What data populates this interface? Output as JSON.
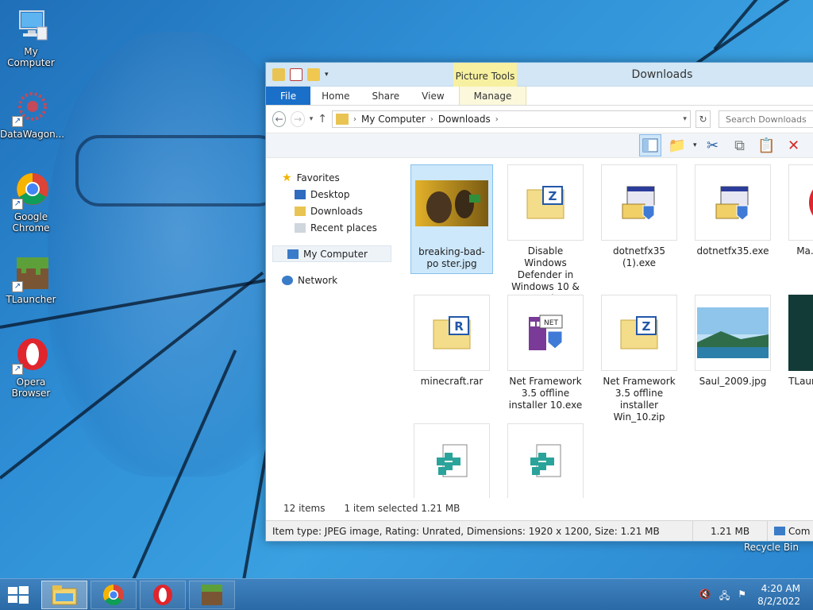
{
  "desktop": {
    "icons": [
      {
        "label": "My Computer"
      },
      {
        "label": "DataWagon..."
      },
      {
        "label": "Google Chrome"
      },
      {
        "label": "TLauncher"
      },
      {
        "label": "Opera Browser"
      }
    ],
    "recycle_bin": "Recycle Bin"
  },
  "window": {
    "title": "Downloads",
    "context_tab_group": "Picture Tools",
    "tabs": [
      "File",
      "Home",
      "Share",
      "View",
      "Manage"
    ],
    "address": {
      "crumbs": [
        "My Computer",
        "Downloads"
      ]
    },
    "search": {
      "placeholder": "Search Downloads"
    },
    "nav": {
      "favorites": "Favorites",
      "desktop": "Desktop",
      "downloads": "Downloads",
      "recent": "Recent places",
      "computer": "My Computer",
      "network": "Network"
    },
    "files": [
      {
        "name": "breaking-bad-poster.jpg",
        "display": "breaking-bad-po ster.jpg"
      },
      {
        "name": "Disable Windows Defender in Windows 10 & 11.zip"
      },
      {
        "name": "dotnetfx35 (1).exe"
      },
      {
        "name": "dotnetfx35.exe"
      },
      {
        "name": "Ma... T... Li..."
      },
      {
        "name": "minecraft.rar"
      },
      {
        "name": "Net Framework 3.5 offline installer 10.exe"
      },
      {
        "name": "Net Framework 3.5 offline installer Win_10.zip"
      },
      {
        "name": "Saul_2009.jpg"
      },
      {
        "name": "TLaun... nstall..."
      },
      {
        "name": ""
      },
      {
        "name": ""
      }
    ],
    "status": {
      "items": "12 items",
      "selected": "1 item selected  1.21 MB",
      "details": "Item type: JPEG image, Rating: Unrated, Dimensions: 1920 x 1200, Size: 1.21 MB",
      "size": "1.21 MB",
      "location": "Com"
    }
  },
  "taskbar": {
    "time": "4:20 AM",
    "date": "8/2/2022"
  },
  "colors": {
    "accent": "#1a6fc9",
    "picture_tools": "#f6f0a0",
    "selection": "#cde8fb"
  }
}
